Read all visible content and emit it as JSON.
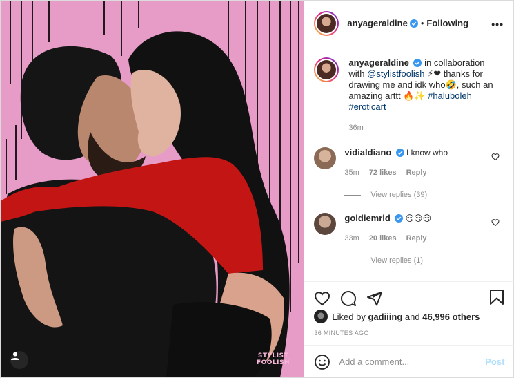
{
  "header": {
    "username": "anyageraldine",
    "verified": true,
    "separator": "•",
    "follow_state": "Following",
    "more_label": "•••"
  },
  "caption": {
    "username": "anyageraldine",
    "text_1": "in collaboration with",
    "mention": "@stylistfoolish",
    "text_2": "thanks for drawing me and idk who",
    "text_3": ", such an amazing arttt",
    "hashtag_1": "#haluboleh",
    "hashtag_2": "#eroticart",
    "emoji_1": "⚡❤",
    "emoji_2": "🤣",
    "emoji_3": "🔥✨",
    "time": "36m"
  },
  "comments": [
    {
      "username": "vidialdiano",
      "text": "I know who",
      "time": "35m",
      "likes": "72 likes",
      "reply": "Reply",
      "view_replies": "View replies (39)"
    },
    {
      "username": "goldiemrld",
      "text": "😏😏😏",
      "time": "33m",
      "likes": "20 likes",
      "reply": "Reply",
      "view_replies": "View replies (1)"
    }
  ],
  "likes": {
    "prefix": "Liked by",
    "user": "gadiiing",
    "middle": "and",
    "count": "46,996 others"
  },
  "timestamp": "36 MINUTES AGO",
  "add_comment": {
    "placeholder": "Add a comment...",
    "post_label": "Post"
  },
  "media": {
    "watermark_line1": "STYLIST",
    "watermark_line2": "FOOLISH",
    "bg_color": "#e79bc7"
  }
}
